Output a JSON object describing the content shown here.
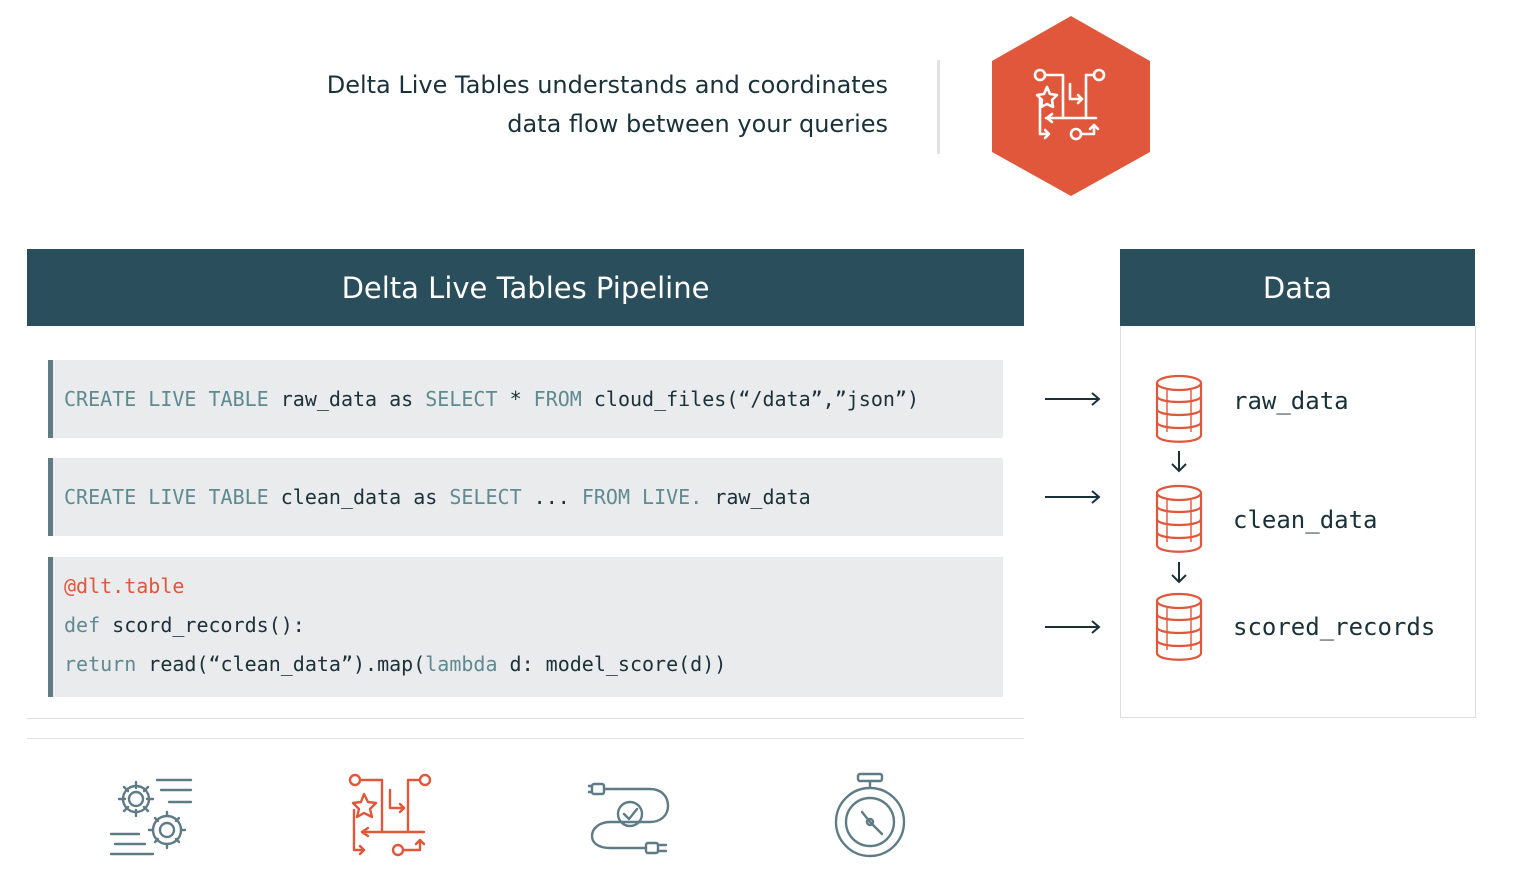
{
  "tagline": {
    "line1": "Delta Live Tables understands and coordinates",
    "line2": "data flow between your queries"
  },
  "pipeline": {
    "title": "Delta Live Tables Pipeline",
    "query1": {
      "create": "CREATE LIVE TABLE",
      "table": "raw_data",
      "as": "as",
      "select": "SELECT",
      "star": "*",
      "from": "FROM",
      "source": "cloud_files(“/data”,”json”)"
    },
    "query2": {
      "create": "CREATE LIVE TABLE",
      "table": "clean_data",
      "as": "as",
      "select": "SELECT",
      "dots": "...",
      "from": "FROM",
      "live": "LIVE.",
      "source": "raw_data"
    },
    "query3": {
      "decorator": "@dlt.table",
      "def": "def",
      "signature": "scord_records():",
      "return": "return",
      "call": "read(“clean_data”).map(",
      "lambda": "lambda",
      "body": "d: model_score(d))"
    }
  },
  "data_panel": {
    "title": "Data",
    "tables": [
      "raw_data",
      "clean_data",
      "scored_records"
    ]
  },
  "icons": {
    "logo": "pipeline-flow-icon",
    "table": "database-icon",
    "features": [
      "gears-automation-icon",
      "pipeline-flow-icon",
      "cable-check-icon",
      "stopwatch-icon"
    ]
  },
  "colors": {
    "header": "#2b4e5c",
    "accent": "#e0573b",
    "keyword": "#5f8a92",
    "codebg": "#e9ebec",
    "feature_icon": "#5f7b86"
  }
}
